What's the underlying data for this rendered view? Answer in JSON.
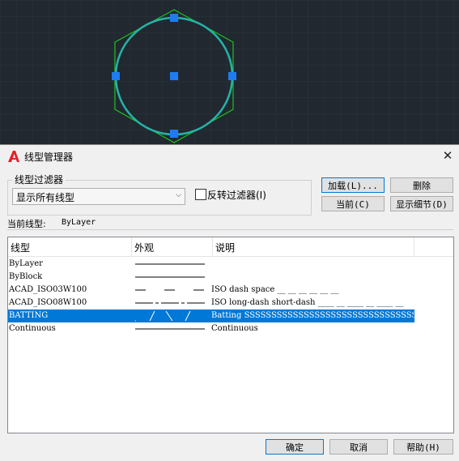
{
  "dialog": {
    "title": "线型管理器",
    "close_glyph": "✕",
    "filter_group_label": "线型过滤器",
    "filter_value": "显示所有线型",
    "invert_label": "反转过滤器(I)",
    "buttons": {
      "load": "加载(L)...",
      "delete": "删除",
      "current": "当前(C)",
      "details": "显示细节(D)"
    },
    "current_linetype_label": "当前线型:",
    "current_linetype_value": "ByLayer",
    "columns": [
      "线型",
      "外观",
      "说明"
    ],
    "rows": [
      {
        "name": "ByLayer",
        "description": "",
        "appearance": "solid",
        "selected": false
      },
      {
        "name": "ByBlock",
        "description": "",
        "appearance": "solid",
        "selected": false
      },
      {
        "name": "ACAD_ISO03W100",
        "description": "ISO dash space __    __    __    __    __    __",
        "appearance": "dash-space",
        "selected": false
      },
      {
        "name": "ACAD_ISO08W100",
        "description": "ISO long-dash short-dash ____ __ ____ __ ____ __",
        "appearance": "long-short",
        "selected": false
      },
      {
        "name": "BATTING",
        "description": "Batting SSSSSSSSSSSSSSSSSSSSSSSSSSSSSSSSSSSS",
        "appearance": "batting",
        "selected": true
      },
      {
        "name": "Continuous",
        "description": "Continuous",
        "appearance": "solid",
        "selected": false
      }
    ],
    "footer": {
      "ok": "确定",
      "cancel": "取消",
      "help": "帮助(H)"
    }
  },
  "colors": {
    "accent": "#0078d7",
    "canvas_bg": "#212830",
    "grip": "#1e7bf2",
    "circle": "#26b3a8",
    "hexagon": "#19c41c"
  },
  "icons": {
    "app": "autocad-logo-icon",
    "close": "close-icon",
    "dropdown": "chevron-down-icon"
  }
}
